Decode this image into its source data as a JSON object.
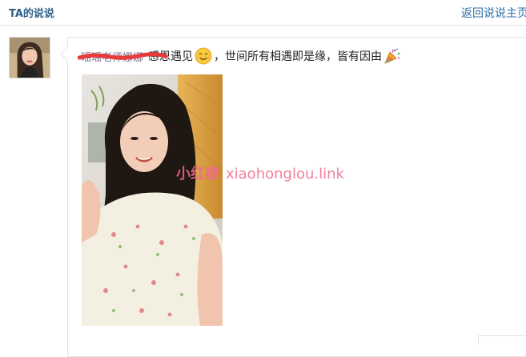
{
  "header": {
    "title": "TA的说说",
    "back_link": "返回说说主页"
  },
  "post": {
    "author": "瑶瑶老师娜娜",
    "text_before_emoji": "感恩遇见",
    "text_after_emoji": "，世间所有相遇即是缘，皆有因由",
    "emoji_1": "smile-emoji",
    "emoji_2": "party-popper-emoji"
  },
  "watermark": {
    "cn": "小红楼",
    "url": "xiaohonglou.link"
  },
  "colors": {
    "header_title": "#2d5f8b",
    "link": "#2d6ea8",
    "redaction": "#e83a3a",
    "watermark": "#f06a8a"
  }
}
